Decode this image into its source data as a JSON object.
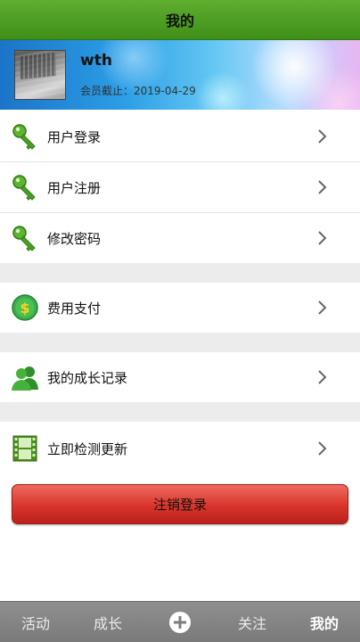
{
  "header": {
    "title": "我的"
  },
  "profile": {
    "username": "wth",
    "membership": "会员截止：2019-04-29"
  },
  "menu": {
    "login": "用户登录",
    "register": "用户注册",
    "change_password": "修改密码",
    "payment": "费用支付",
    "growth_records": "我的成长记录",
    "check_update": "立即检测更新"
  },
  "logout_label": "注销登录",
  "tabbar": {
    "activity": "活动",
    "growth": "成长",
    "follow": "关注",
    "mine": "我的"
  },
  "colors": {
    "header_green": "#4a9a22",
    "logout_red": "#d8352b",
    "tabbar_gray": "#858585",
    "icon_key_green": "#3f9a1e"
  },
  "icons": {
    "login": "key-icon",
    "register": "key-icon",
    "change_password": "key-icon",
    "payment": "dollar-coin-icon",
    "growth_records": "users-icon",
    "check_update": "film-strip-icon",
    "add": "plus-circle-icon"
  }
}
